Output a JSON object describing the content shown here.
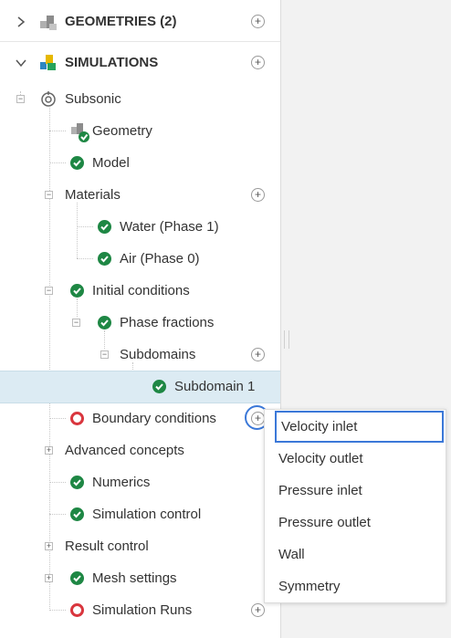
{
  "tree": {
    "geometries_label": "GEOMETRIES (2)",
    "simulations_label": "SIMULATIONS",
    "subsonic": "Subsonic",
    "geometry": "Geometry",
    "model": "Model",
    "materials": "Materials",
    "water": "Water (Phase 1)",
    "air": "Air (Phase 0)",
    "initial_conditions": "Initial conditions",
    "phase_fractions": "Phase fractions",
    "subdomains": "Subdomains",
    "subdomain_1": "Subdomain 1",
    "boundary_conditions": "Boundary conditions",
    "advanced_concepts": "Advanced concepts",
    "numerics": "Numerics",
    "simulation_control": "Simulation control",
    "result_control": "Result control",
    "mesh_settings": "Mesh settings",
    "simulation_runs": "Simulation Runs"
  },
  "menu": {
    "items": [
      "Velocity inlet",
      "Velocity outlet",
      "Pressure inlet",
      "Pressure outlet",
      "Wall",
      "Symmetry"
    ]
  },
  "glyphs": {
    "plus": "+",
    "minus": "−"
  },
  "colors": {
    "check": "#1e8744",
    "error": "#d9363e",
    "selected": "#dcebf3",
    "highlight": "#3b78d8"
  }
}
